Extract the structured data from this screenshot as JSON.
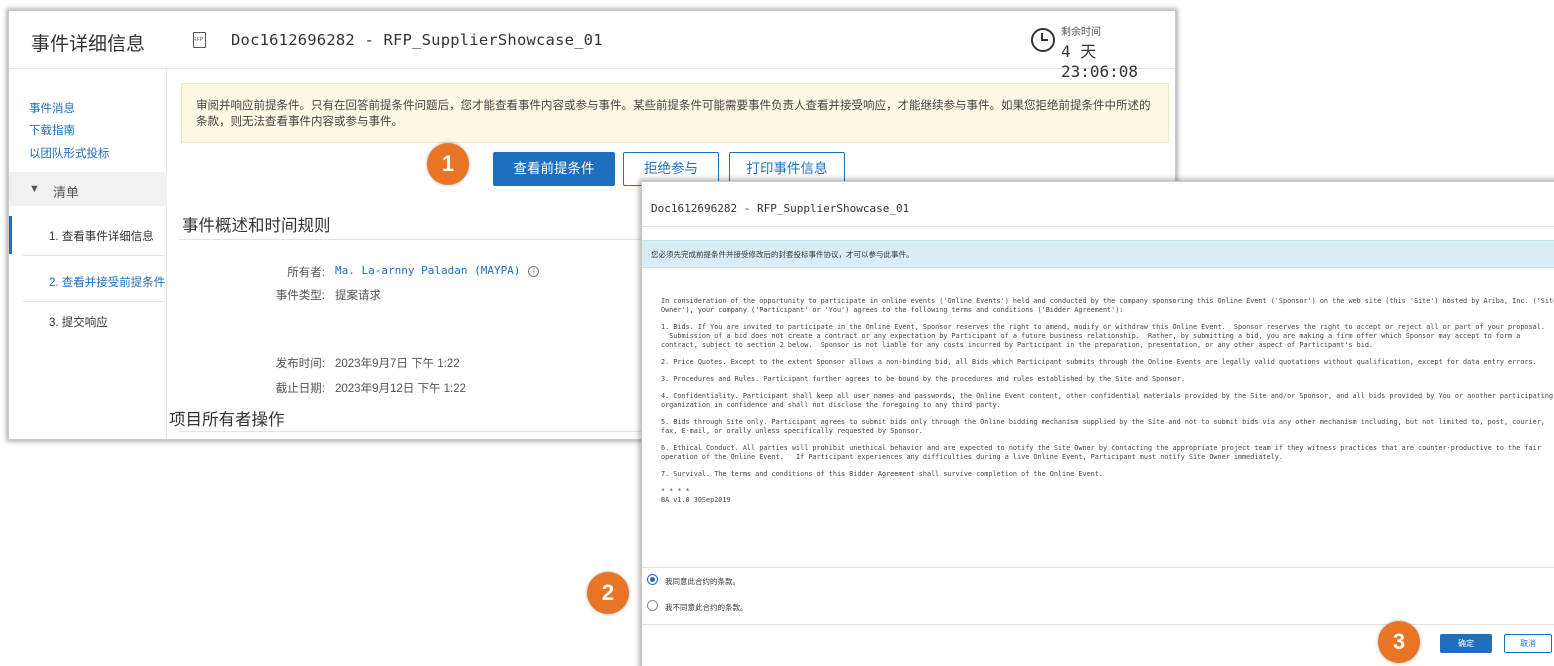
{
  "event_window": {
    "title": "事件详细信息",
    "doc_title": "Doc1612696282 - RFP_SupplierShowcase_01",
    "time_remaining_label": "剩余时间",
    "time_remaining_value": "4 天 23:06:08",
    "sidebar": {
      "links": [
        "事件消息",
        "下载指南",
        "以团队形式投标"
      ],
      "checklist_label": "清单",
      "steps": [
        "1. 查看事件详细信息",
        "2. 查看并接受前提条件",
        "3. 提交响应"
      ]
    },
    "notice": "审阅并响应前提条件。只有在回答前提条件问题后，您才能查看事件内容或参与事件。某些前提条件可能需要事件负责人查看并接受响应，才能继续参与事件。如果您拒绝前提条件中所述的条款，则无法查看事件内容或参与事件。",
    "buttons": {
      "view_prerequisites": "查看前提条件",
      "decline": "拒绝参与",
      "print": "打印事件信息"
    },
    "section_title": "事件概述和时间规则",
    "owner_label": "所有者:",
    "owner_value": "Ma. La-arnny Paladan (MAYPA)",
    "event_type_label": "事件类型:",
    "event_type_value": "提案请求",
    "publish_label": "发布时间:",
    "publish_value": "2023年9月7日 下午 1:22",
    "due_label": "截止日期:",
    "due_value": "2023年9月12日 下午 1:22",
    "section2_title": "项目所有者操作"
  },
  "agreement_dialog": {
    "title": "Doc1612696282 - RFP_SupplierShowcase_01",
    "info": "您必须先完成前提条件并接受修改后的封套投标事件协议，才可以参与此事件。",
    "paragraphs": [
      "In consideration of the opportunity to participate in online events ('Online Events') held and conducted by the company sponsoring this Online Event ('Sponsor') on the web site (this 'Site') hosted by Ariba, Inc. ('Site Owner'), your company ('Participant' or 'You') agrees to the following terms and conditions ('Bidder Agreement'):",
      "1. Bids. If You are invited to participate in the Online Event, Sponsor reserves the right to amend, modify or withdraw this Online Event.  Sponsor reserves the right to accept or reject all or part of your proposal.\n  Submission of a bid does not create a contract or any expectation by Participant of a future business relationship.  Rather, by submitting a bid, you are making a firm offer which Sponsor may accept to form a contract, subject to section 2 below.  Sponsor is not liable for any costs incurred by Participant in the preparation, presentation, or any other aspect of Participant's bid.",
      "2. Price Quotes. Except to the extent Sponsor allows a non-binding bid, all Bids which Participant submits through the Online Events are legally valid quotations without qualification, except for data entry errors.",
      "3. Procedures and Rules. Participant further agrees to be bound by the procedures and rules established by the Site and Sponsor.",
      "4. Confidentiality. Participant shall keep all user names and passwords, the Online Event content, other confidential materials provided by the Site and/or Sponsor, and all bids provided by You or another participating organization in confidence and shall not disclose the foregoing to any third party.",
      "5. Bids through Site only. Participant agrees to submit bids only through the Online bidding mechanism supplied by the Site and not to submit bids via any other mechanism including, but not limited to, post, courier, fax, E-mail, or orally unless specifically requested by Sponsor.",
      "6. Ethical Conduct. All parties will prohibit unethical behavior and are expected to notify the Site Owner by contacting the appropriate project team if they witness practices that are counter-productive to the fair operation of the Online Event.   If Participant experiences any difficulties during a live Online Event, Participant must notify Site Owner immediately.",
      "7. Survival. The terms and conditions of this Bidder Agreement shall survive completion of the Online Event.",
      "* * * *\nBA v1.0 30Sep2019"
    ],
    "accept_label": "我同意此合约的条款。",
    "decline_label": "我不同意此合约的条款。",
    "accept_selected": true,
    "ok_label": "确定",
    "cancel_label": "取消"
  },
  "steps": [
    "1",
    "2",
    "3"
  ],
  "colors": {
    "primary": "#1f6fbf",
    "badge": "#e87424",
    "notice_bg": "#fcf8e3",
    "info_bg": "#d9edf7"
  }
}
